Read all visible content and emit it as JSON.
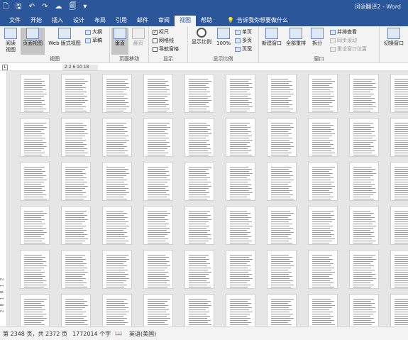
{
  "titlebar": {
    "doc_title": "词语翻译2 - Word",
    "qat": [
      {
        "name": "new-doc-icon",
        "glyph": "🗋"
      },
      {
        "name": "save-icon",
        "glyph": "🖫"
      },
      {
        "name": "undo-icon",
        "glyph": "↶"
      },
      {
        "name": "redo-icon",
        "glyph": "↷"
      },
      {
        "name": "cloud-icon",
        "glyph": "☁"
      },
      {
        "name": "print-preview-icon",
        "glyph": "🗐"
      },
      {
        "name": "customize-qat-icon",
        "glyph": "▾"
      }
    ]
  },
  "tabs": [
    "文件",
    "开始",
    "插入",
    "设计",
    "布局",
    "引用",
    "邮件",
    "审阅",
    "视图",
    "帮助"
  ],
  "active_tab": "视图",
  "tell_me": {
    "icon": "lightbulb-icon",
    "glyph": "💡",
    "text": "告诉我你想要做什么"
  },
  "ribbon": {
    "views": {
      "label": "视图",
      "read_mode": "阅读\n视图",
      "print_layout": "页面视图",
      "web_layout": "Web 版式视图",
      "outline": "大纲",
      "draft": "草稿"
    },
    "page_movement": {
      "label": "页面移动",
      "vertical": "垂直",
      "side_to_side": "翻页"
    },
    "show": {
      "label": "显示",
      "ruler": {
        "text": "标尺",
        "checked": true
      },
      "gridlines": {
        "text": "网格线",
        "checked": false
      },
      "nav_pane": {
        "text": "导航窗格",
        "checked": false
      }
    },
    "zoom": {
      "label": "显示比例",
      "zoom": "显示比例",
      "hundred": "100%",
      "one_page": "单页",
      "multi_page": "多页",
      "page_width": "页宽"
    },
    "window": {
      "label": "窗口",
      "new_window": "新建窗口",
      "arrange_all": "全部重排",
      "split": "拆分",
      "side_by_side": "并排查看",
      "sync_scroll": "同步滚动",
      "reset_position": "重设窗口位置",
      "switch_windows": "切换窗口"
    }
  },
  "ruler": {
    "corner": "L",
    "marks": "2   2  6  10    18"
  },
  "vruler": [
    "2",
    "1",
    "8",
    "1",
    "8",
    "2"
  ],
  "thumbnails": {
    "rows": 6,
    "cols": 10
  },
  "status": {
    "page_info": "第 2348 页，共 2372 页",
    "word_count": "1772014 个字",
    "proof_icon": "📖",
    "language": "英语(美国)"
  }
}
